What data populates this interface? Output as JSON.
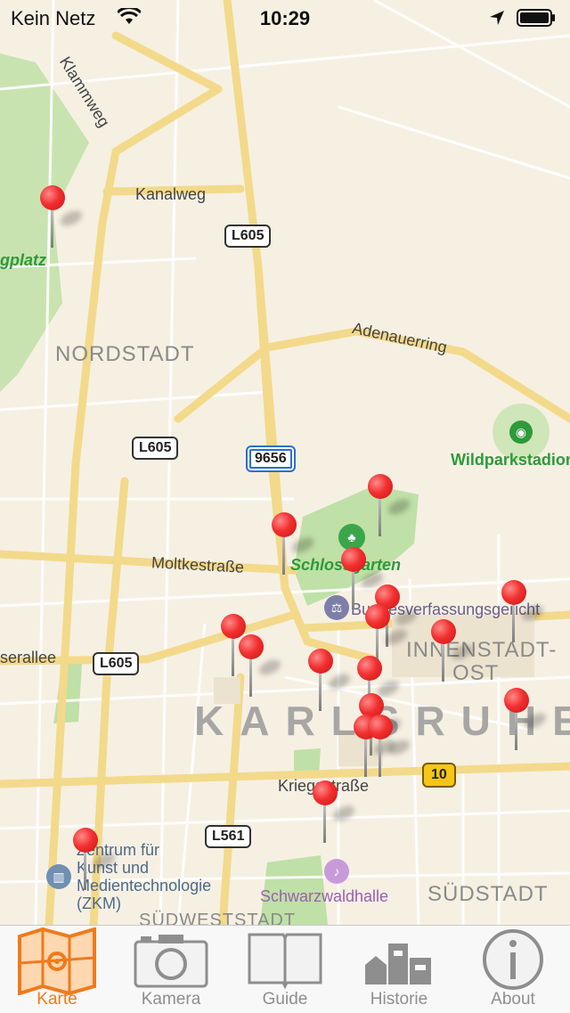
{
  "status_bar": {
    "carrier": "Kein Netz",
    "time": "10:29"
  },
  "map": {
    "city": "KARLSRUHE",
    "districts": [
      "NORDSTADT",
      "INNENSTADT-",
      "OST",
      "SÜDSTADT",
      "SÜDWESTSTADT"
    ],
    "streets": [
      "Klammweg",
      "Kanalweg",
      "Adenauerring",
      "Moltkestraße",
      "Kriegsstraße",
      "serallee"
    ],
    "parks": [
      "Schlossgarten",
      "Wildparkstadion",
      "gplatz"
    ],
    "pois": [
      "Bundesverfassungsgericht",
      "Zentrum für",
      "Kunst und",
      "Medientechnologie",
      "(ZKM)",
      "Schwarzwaldhalle"
    ],
    "road_shields": [
      "L605",
      "L605",
      "L605",
      "9656",
      "L561",
      "10"
    ]
  },
  "tabs": [
    {
      "label": "Karte",
      "icon": "map-icon",
      "active": true
    },
    {
      "label": "Kamera",
      "icon": "camera-icon",
      "active": false
    },
    {
      "label": "Guide",
      "icon": "book-icon",
      "active": false
    },
    {
      "label": "Historie",
      "icon": "buildings-icon",
      "active": false
    },
    {
      "label": "About",
      "icon": "info-icon",
      "active": false
    }
  ],
  "colors": {
    "accent": "#f07a1c",
    "pin": "#f23030",
    "park": "#2e9a3a",
    "inactive_tab": "#8e8e8e"
  }
}
